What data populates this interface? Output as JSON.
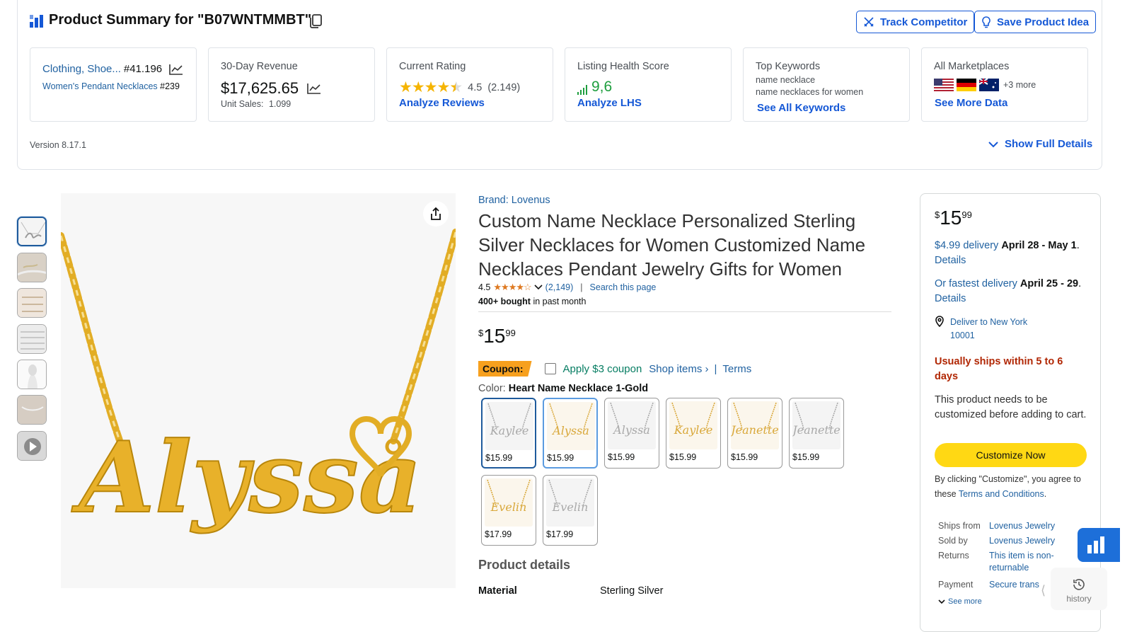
{
  "summary": {
    "title": "Product Summary for \"B07WNTMMBT\"",
    "track_label": "Track Competitor",
    "save_label": "Save Product Idea",
    "version": "Version 8.17.1",
    "show_full": "Show Full Details",
    "cards": {
      "category": {
        "cat1": "Clothing, Shoe...",
        "rank1": "#41.196",
        "cat2": "Women's Pendant Necklaces",
        "rank2": "#239"
      },
      "revenue": {
        "label": "30-Day Revenue",
        "value": "$17,625.65",
        "unit_label": "Unit Sales:",
        "unit_value": "1.099"
      },
      "rating": {
        "label": "Current Rating",
        "value": "4.5",
        "count": "(2.149)",
        "link": "Analyze Reviews",
        "stars": 4.5
      },
      "health": {
        "label": "Listing Health Score",
        "value": "9,6",
        "link": "Analyze LHS"
      },
      "keywords": {
        "label": "Top Keywords",
        "kw1": "name necklace",
        "kw2": "name necklaces for women",
        "link": "See All Keywords"
      },
      "marketplaces": {
        "label": "All Marketplaces",
        "more": "+3 more",
        "link": "See More Data",
        "flags": [
          "us-flag",
          "de-flag",
          "au-flag"
        ]
      }
    }
  },
  "product": {
    "brand": "Brand: Lovenus",
    "title": "Custom Name Necklace Personalized Sterling Silver Necklaces for Women Customized Name Necklaces Pendant Jewelry Gifts for Women",
    "rating": "4.5",
    "reviews": "(2,149)",
    "search_page": "Search this page",
    "bought_bold": "400+ bought",
    "bought_rest": " in past month",
    "price": {
      "symbol": "$",
      "whole": "15",
      "fraction": "99"
    },
    "coupon": {
      "badge": "Coupon:",
      "apply": "Apply $3 coupon",
      "shop": "Shop items ›",
      "sep": "|",
      "terms": "Terms"
    },
    "color_label": "Color:",
    "color_value": "Heart Name Necklace 1-Gold",
    "swatches": [
      {
        "price": "$15.99",
        "name": "Kaylee",
        "tone": "silver"
      },
      {
        "price": "$15.99",
        "name": "Alyssa",
        "tone": "gold"
      },
      {
        "price": "$15.99",
        "name": "Alyssa",
        "tone": "silver"
      },
      {
        "price": "$15.99",
        "name": "Kaylee",
        "tone": "gold"
      },
      {
        "price": "$15.99",
        "name": "Jeanette",
        "tone": "gold"
      },
      {
        "price": "$15.99",
        "name": "Jeanette",
        "tone": "silver"
      },
      {
        "price": "$17.99",
        "name": "Evelin",
        "tone": "gold"
      },
      {
        "price": "$17.99",
        "name": "Evelin",
        "tone": "silver"
      }
    ],
    "details_title": "Product details",
    "material_label": "Material",
    "material_value": "Sterling Silver",
    "main_image_text": "Alyssa"
  },
  "buybox": {
    "price": {
      "symbol": "$",
      "whole": "15",
      "fraction": "99"
    },
    "delivery_pre": "$4.99 delivery ",
    "delivery_date": "April 28 - May 1",
    "delivery_post": ".",
    "details": "Details",
    "fast_pre": "Or fastest delivery ",
    "fast_date": "April 25 - 29",
    "fast_post": ".",
    "deliver_to_1": "Deliver to New York",
    "deliver_to_2": "10001",
    "ships_warn": "Usually ships within 5 to 6 days",
    "custom_note": "This product needs to be customized before adding to cart.",
    "customize_btn": "Customize Now",
    "agree_pre": "By clicking \"Customize\", you agree to these ",
    "agree_link": "Terms and Conditions",
    "agree_post": ".",
    "ships_from_l": "Ships from",
    "ships_from_v": "Lovenus Jewelry",
    "sold_by_l": "Sold by",
    "sold_by_v": "Lovenus Jewelry",
    "returns_l": "Returns",
    "returns_v": "This item is non-returnable",
    "payment_l": "Payment",
    "payment_v": "Secure trans",
    "see_more": "See more"
  },
  "history_label": "history"
}
